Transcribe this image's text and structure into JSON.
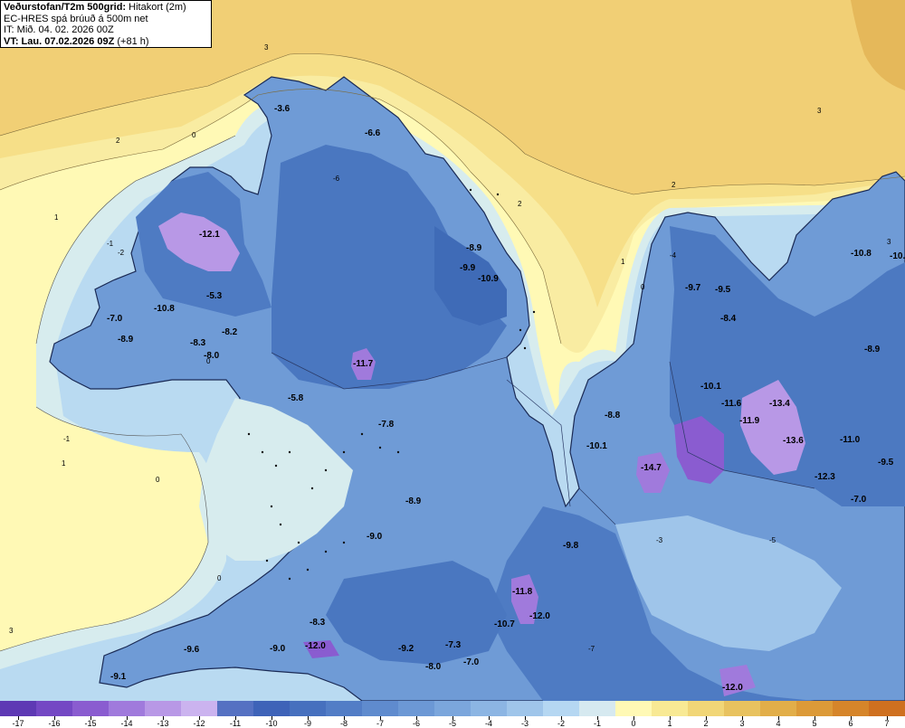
{
  "header": {
    "title_bold": "Veðurstofan/T2m 500grid:",
    "title_rest": "Hitakort (2m)",
    "line2": "EC-HRES spá brúuð á 500m net",
    "line3": "IT: Mið. 04. 02. 2026 00Z",
    "line4_bold": "VT: Lau. 07.02.2026 09Z",
    "line4_rest": "(+81 h)"
  },
  "legend": {
    "labels": [
      "-17",
      "-16",
      "-15",
      "-14",
      "-13",
      "-12",
      "-11",
      "-10",
      "-9",
      "-8",
      "-7",
      "-6",
      "-5",
      "-4",
      "-3",
      "-2",
      "-1",
      "0",
      "1",
      "2",
      "3",
      "4",
      "5",
      "6",
      "7"
    ],
    "colors": [
      "#5e39b4",
      "#7448c4",
      "#8a5cd0",
      "#a07adc",
      "#b898e6",
      "#cbb3ef",
      "#5571c2",
      "#3e63b8",
      "#4670be",
      "#527dc6",
      "#5f8bce",
      "#6c98d5",
      "#7ba6dc",
      "#8cb5e3",
      "#9fc5ea",
      "#b5d7f2",
      "#d6e9f0",
      "#fff9b5",
      "#f8e994",
      "#f1d677",
      "#e8c25f",
      "#e2ae49",
      "#dc9a38",
      "#d6852a",
      "#cf7020"
    ]
  },
  "map_labels": [
    {
      "text": "-3.6"
    },
    {
      "text": "-6.6"
    },
    {
      "text": "-12.1"
    },
    {
      "text": "-5.3"
    },
    {
      "text": "-10.8"
    },
    {
      "text": "-7.0"
    },
    {
      "text": "-8.9"
    },
    {
      "text": "-8.3"
    },
    {
      "text": "-8.2"
    },
    {
      "text": "-8.0"
    },
    {
      "text": "-11.7"
    },
    {
      "text": "-8.9"
    },
    {
      "text": "-9.9"
    },
    {
      "text": "-10.9"
    },
    {
      "text": "-5.8"
    },
    {
      "text": "-7.8"
    },
    {
      "text": "-8.9"
    },
    {
      "text": "-9.0"
    },
    {
      "text": "-9.8"
    },
    {
      "text": "-11.8"
    },
    {
      "text": "-10.7"
    },
    {
      "text": "-12.0"
    },
    {
      "text": "-8.3"
    },
    {
      "text": "-9.6"
    },
    {
      "text": "-9.0"
    },
    {
      "text": "-12.0"
    },
    {
      "text": "-9.2"
    },
    {
      "text": "-7.3"
    },
    {
      "text": "-8.0"
    },
    {
      "text": "-7.0"
    },
    {
      "text": "-9.1"
    },
    {
      "text": "-9.7"
    },
    {
      "text": "-9.5"
    },
    {
      "text": "-8.4"
    },
    {
      "text": "-10.1"
    },
    {
      "text": "-11.6"
    },
    {
      "text": "-13.4"
    },
    {
      "text": "-11.9"
    },
    {
      "text": "-13.6"
    },
    {
      "text": "-8.8"
    },
    {
      "text": "-10.1"
    },
    {
      "text": "-14.7"
    },
    {
      "text": "-12.3"
    },
    {
      "text": "-7.0"
    },
    {
      "text": "-11.0"
    },
    {
      "text": "-9.5"
    },
    {
      "text": "-10.8"
    },
    {
      "text": "-10.7"
    },
    {
      "text": "-8.9"
    },
    {
      "text": "-12.0"
    }
  ],
  "contour_labels": [
    {
      "text": "3"
    },
    {
      "text": "3"
    },
    {
      "text": "3"
    },
    {
      "text": "3"
    },
    {
      "text": "2"
    },
    {
      "text": "2"
    },
    {
      "text": "2"
    },
    {
      "text": "1"
    },
    {
      "text": "1"
    },
    {
      "text": "1"
    },
    {
      "text": "0"
    },
    {
      "text": "0"
    },
    {
      "text": "0"
    },
    {
      "text": "0"
    },
    {
      "text": "0"
    },
    {
      "text": "-1"
    },
    {
      "text": "-1"
    },
    {
      "text": "-2"
    },
    {
      "text": "-4"
    },
    {
      "text": "-6"
    },
    {
      "text": "-5"
    },
    {
      "text": "-3"
    },
    {
      "text": "-7"
    }
  ]
}
